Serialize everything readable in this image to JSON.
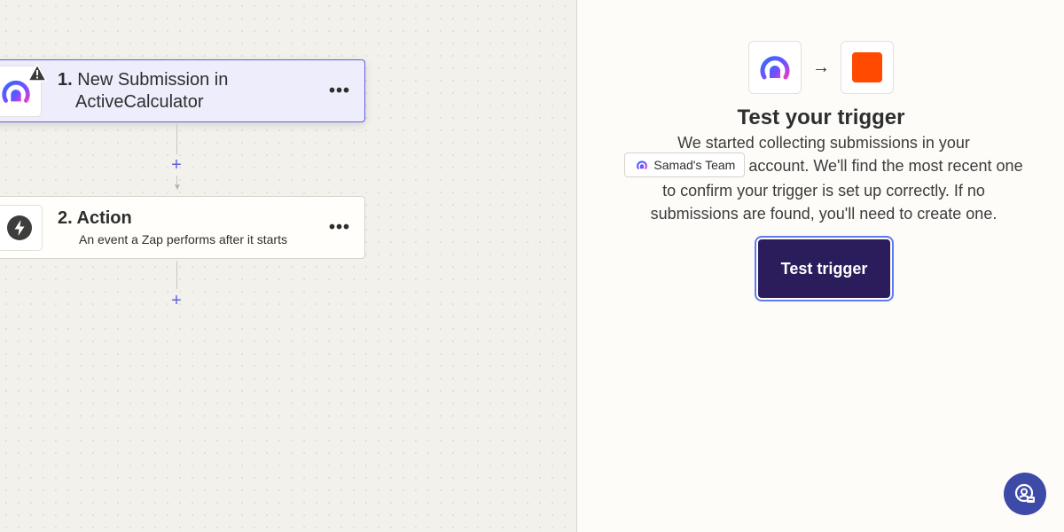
{
  "canvas": {
    "trigger_step": {
      "number": "1.",
      "title_line1": "New Submission in",
      "title_line2": "ActiveCalculator",
      "app_icon": "activecalculator-logo-icon",
      "warning_icon": "warning-triangle-icon",
      "menu_label": "•••"
    },
    "action_step": {
      "number": "2.",
      "title": "Action",
      "subtitle": "An event a Zap performs after it starts",
      "app_icon": "lightning-bolt-icon",
      "menu_label": "•••"
    },
    "add_step_label": "+"
  },
  "panel": {
    "flow_from_icon": "activecalculator-logo-icon",
    "flow_arrow": "→",
    "flow_to_icon": "zapier-orange-square-icon",
    "title": "Test your trigger",
    "desc_before": "We started collecting submissions in your",
    "team_chip": "Samad's Team",
    "desc_after": "account. We'll find the most recent one to confirm your trigger is set up correctly. If no submissions are found, you'll need to create one.",
    "test_button_label": "Test trigger"
  },
  "help": {
    "icon": "help-chat-icon"
  },
  "colors": {
    "accent": "#5f5ee0",
    "button_bg": "#2b1d5c",
    "zapier_orange": "#ff4a00",
    "help_bg": "#3d4aa8"
  }
}
